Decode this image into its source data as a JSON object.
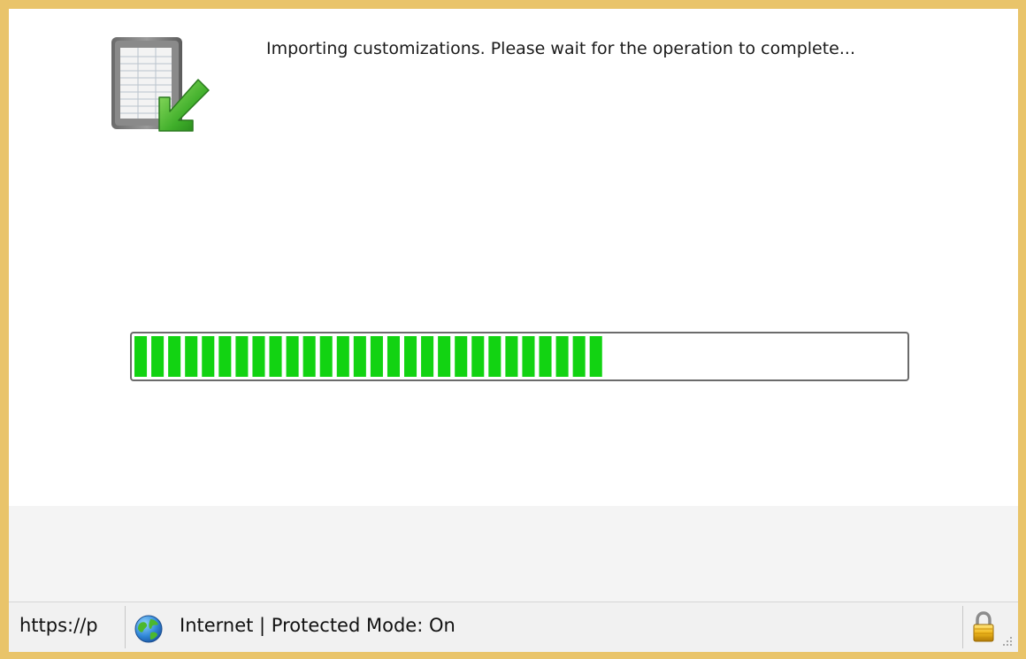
{
  "dialog": {
    "message": "Importing customizations. Please wait for the operation to complete...",
    "icon": "import-document-icon"
  },
  "progress": {
    "value_fraction": 0.61,
    "segments_filled": 28,
    "fill_color": "#12d312",
    "track_border_color": "#6b6b6b"
  },
  "status_bar": {
    "url": "https://p",
    "zone_icon": "globe-icon",
    "zone_text": "Internet | Protected Mode: On",
    "security_icon": "lock-icon"
  },
  "colors": {
    "frame": "#e9c46a",
    "status_bar_bg": "#f1f1f1",
    "footer_bg": "#f4f4f4"
  }
}
